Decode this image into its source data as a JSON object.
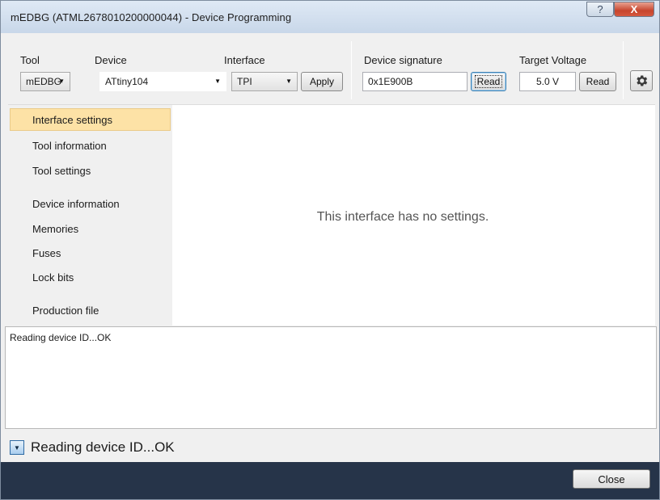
{
  "window": {
    "title": "mEDBG (ATML2678010200000044) - Device Programming",
    "help_glyph": "?",
    "close_glyph": "X"
  },
  "toolbar": {
    "tool_label": "Tool",
    "tool_value": "mEDBG",
    "device_label": "Device",
    "device_value": "ATtiny104",
    "interface_label": "Interface",
    "interface_value": "TPI",
    "apply_label": "Apply",
    "signature_label": "Device signature",
    "signature_value": "0x1E900B",
    "signature_read_label": "Read",
    "voltage_label": "Target Voltage",
    "voltage_value": "5.0 V",
    "voltage_read_label": "Read",
    "settings_icon": "gear-icon"
  },
  "nav": {
    "items": [
      {
        "label": "Interface settings"
      },
      {
        "label": "Tool information"
      },
      {
        "label": "Tool settings"
      },
      {
        "label": "Device information"
      },
      {
        "label": "Memories"
      },
      {
        "label": "Fuses"
      },
      {
        "label": "Lock bits"
      },
      {
        "label": "Production file"
      }
    ],
    "selected": "Interface settings"
  },
  "content": {
    "message": "This interface has no settings."
  },
  "log": {
    "text": "Reading device ID...OK"
  },
  "status": {
    "text": "Reading device ID...OK",
    "expand_icon": "chevron-down-icon"
  },
  "footer": {
    "close_label": "Close"
  },
  "colors": {
    "footer_bg": "#263449",
    "selected_bg": "#fde2a6",
    "close_caption": "#c7452d"
  }
}
